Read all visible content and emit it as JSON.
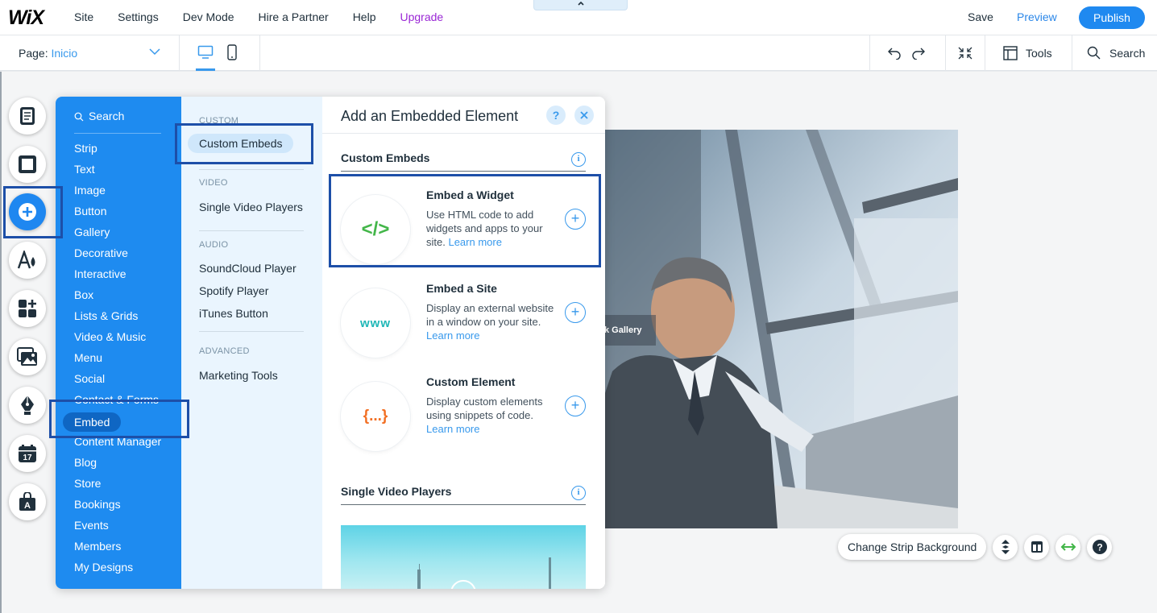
{
  "topbar": {
    "logo": "WiX",
    "menu": [
      "Site",
      "Settings",
      "Dev Mode",
      "Hire a Partner",
      "Help",
      "Upgrade"
    ],
    "collapse_icon": "chevron-up-icon",
    "save": "Save",
    "preview": "Preview",
    "publish": "Publish"
  },
  "subbar": {
    "page_prefix": "Page:",
    "page_name": "Inicio",
    "tools": "Tools",
    "search": "Search"
  },
  "sidebar": {
    "buttons": [
      "pages-icon",
      "background-icon",
      "add-icon",
      "theme-icon",
      "app-market-icon",
      "media-icon",
      "blog-pen-icon",
      "bookings-icon",
      "store-bag-icon"
    ],
    "active": "add-icon",
    "bookings_day": "17",
    "store_letter": "A"
  },
  "add_panel": {
    "search": "Search",
    "categories": [
      "Strip",
      "Text",
      "Image",
      "Button",
      "Gallery",
      "Decorative",
      "Interactive",
      "Box",
      "Lists & Grids",
      "Video & Music",
      "Menu",
      "Social",
      "Contact & Forms",
      "Embed",
      "Content Manager",
      "Blog",
      "Store",
      "Bookings",
      "Events",
      "Members",
      "My Designs"
    ],
    "selected_category": "Embed",
    "sub": {
      "custom_head": "CUSTOM",
      "custom_sel": "Custom Embeds",
      "video_head": "VIDEO",
      "video_item": "Single Video Players",
      "audio_head": "AUDIO",
      "audio_items": [
        "SoundCloud Player",
        "Spotify Player",
        "iTunes Button"
      ],
      "advanced_head": "ADVANCED",
      "advanced_item": "Marketing Tools"
    },
    "main": {
      "title": "Add an Embedded Element",
      "help": "?",
      "section1": "Custom Embeds",
      "section2": "Single Video Players",
      "info": "i",
      "items": [
        {
          "icon": "</>",
          "icon_color": "#43b649",
          "title": "Embed a Widget",
          "desc": "Use HTML code to add widgets and apps to your site.",
          "learn": "Learn more"
        },
        {
          "icon": "www",
          "icon_color": "#1fb7b7",
          "title": "Embed a Site",
          "desc": "Display an external website in a window on your site.",
          "learn": "Learn more"
        },
        {
          "icon": "{...}",
          "icon_color": "#f26f23",
          "title": "Custom Element",
          "desc": "Display custom elements using snippets of code.",
          "learn": "Learn more"
        }
      ]
    }
  },
  "canvas": {
    "photo_tag": "k Gallery",
    "change_strip_bg": "Change Strip Background",
    "strip_icons": [
      "layers-icon",
      "layout-icon",
      "stretch-icon",
      "help-icon"
    ]
  },
  "colors": {
    "accent": "#1e89f0",
    "highlight_box": "#1d4fa8",
    "upgrade": "#9a27d5"
  }
}
